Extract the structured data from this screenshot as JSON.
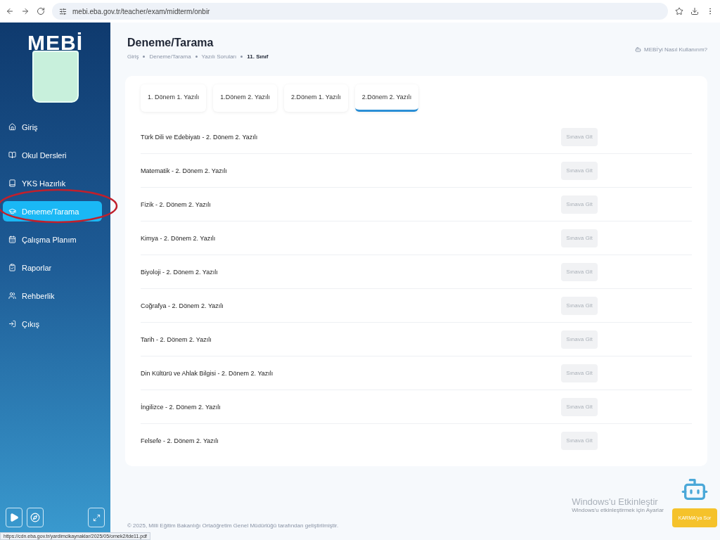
{
  "browser": {
    "address": "mebi.eba.gov.tr/teacher/exam/midterm/onbir",
    "status_url": "https://cdn.eba.gov.tr/yardimcikaynaklar/2025/05/ornek2/tde11.pdf"
  },
  "sidebar": {
    "logo": "MEBİ",
    "items": [
      {
        "label": "Giriş",
        "selected": false
      },
      {
        "label": "Okul Dersleri",
        "selected": false
      },
      {
        "label": "YKS Hazırlık",
        "selected": false
      },
      {
        "label": "Deneme/Tarama",
        "selected": true
      },
      {
        "label": "Çalışma Planım",
        "selected": false
      },
      {
        "label": "Raporlar",
        "selected": false
      },
      {
        "label": "Rehberlik",
        "selected": false
      },
      {
        "label": "Çıkış",
        "selected": false
      }
    ]
  },
  "header": {
    "title": "Deneme/Tarama",
    "breadcrumb": [
      "Giriş",
      "Deneme/Tarama",
      "Yazılı Soruları",
      "11. Sınıf"
    ],
    "help_link": "MEBİ'yi Nasıl Kullanırım?"
  },
  "tabs": [
    {
      "label": "1. Dönem 1. Yazılı",
      "selected": false
    },
    {
      "label": "1.Dönem 2. Yazılı",
      "selected": false
    },
    {
      "label": "2.Dönem 1. Yazılı",
      "selected": false
    },
    {
      "label": "2.Dönem 2. Yazılı",
      "selected": true
    }
  ],
  "exams": [
    {
      "title": "Türk Dili ve Edebiyatı - 2. Dönem 2. Yazılı",
      "button": "Sınava Git"
    },
    {
      "title": "Matematik - 2. Dönem 2. Yazılı",
      "button": "Sınava Git"
    },
    {
      "title": "Fizik - 2. Dönem 2. Yazılı",
      "button": "Sınava Git"
    },
    {
      "title": "Kimya - 2. Dönem 2. Yazılı",
      "button": "Sınava Git"
    },
    {
      "title": "Biyoloji - 2. Dönem 2. Yazılı",
      "button": "Sınava Git"
    },
    {
      "title": "Coğrafya - 2. Dönem 2. Yazılı",
      "button": "Sınava Git"
    },
    {
      "title": "Tarih - 2. Dönem 2. Yazılı",
      "button": "Sınava Git"
    },
    {
      "title": "Din Kültürü ve Ahlak Bilgisi - 2. Dönem 2. Yazılı",
      "button": "Sınava Git"
    },
    {
      "title": "İngilizce - 2. Dönem 2. Yazılı",
      "button": "Sınava Git"
    },
    {
      "title": "Felsefe - 2. Dönem 2. Yazılı",
      "button": "Sınava Git"
    }
  ],
  "footer": "© 2025, Milli Eğitim Bakanlığı Ortaöğretim Genel Müdürlüğü tarafından geliştirilmiştir.",
  "windows_notice": {
    "title": "Windows'u Etkinleştir",
    "subtitle": "Windows'u etkinleştirmek için Ayarlar"
  },
  "chat_button": "KARMA'ya Sor"
}
